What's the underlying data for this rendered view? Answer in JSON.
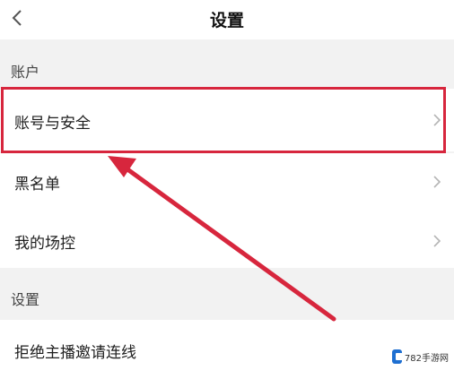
{
  "header": {
    "title": "设置",
    "back_icon": "chevron-left-icon"
  },
  "sections": [
    {
      "label": "账户",
      "items": [
        {
          "label": "账号与安全"
        },
        {
          "label": "黑名单"
        },
        {
          "label": "我的场控"
        }
      ]
    },
    {
      "label": "设置",
      "items": [
        {
          "label": "拒绝主播邀请连线"
        }
      ]
    }
  ],
  "annotation": {
    "highlight_color": "#d7263d",
    "target": "账号与安全"
  },
  "watermark": {
    "text": "782手游网"
  }
}
